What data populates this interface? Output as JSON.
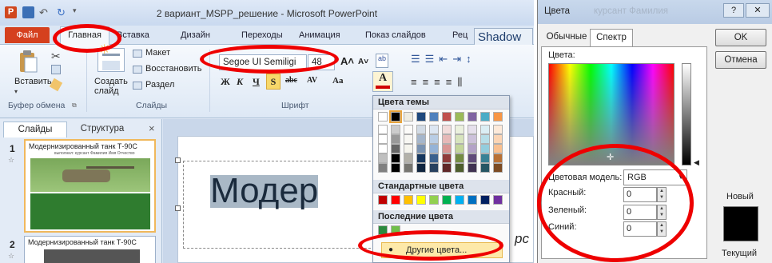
{
  "window": {
    "title": "2 вариант_MSPP_решение  -  Microsoft PowerPoint",
    "app_icon_letter": "P"
  },
  "ribbon_tabs": [
    "Файл",
    "Главная",
    "Вставка",
    "Дизайн",
    "Переходы",
    "Анимация",
    "Показ слайдов",
    "Рец"
  ],
  "ribbon": {
    "paste_label": "Вставить",
    "create_slide_label": "Создать\nслайд",
    "layout_label": "Макет",
    "reset_label": "Восстановить",
    "section_label": "Раздел",
    "font_name": "Segoe UI Semiligi",
    "font_size": "48",
    "format_buttons": [
      "Ж",
      "К",
      "Ч",
      "S",
      "abc",
      "AV",
      "Aa",
      "A"
    ],
    "groups": [
      "Буфер обмена",
      "Слайды",
      "Шрифт"
    ],
    "shadow_tooltip": "Shadow"
  },
  "slide_panel": {
    "tabs": [
      "Слайды",
      "Структура"
    ],
    "close": "×",
    "slides": [
      {
        "number": "1",
        "title": "Модернизированный танк Т-90С",
        "subtitle": "выполнил: курсант Фамилия Имя Отчество"
      },
      {
        "number": "2",
        "title": "Модернизированный танк Т-90С"
      }
    ]
  },
  "slide": {
    "title_text": "Модер",
    "right_fragment": "рс"
  },
  "palette": {
    "theme_header": "Цвета темы",
    "standard_header": "Стандартные цвета",
    "recent_header": "Последние цвета",
    "more_colors": "Другие цвета...",
    "theme_colors": [
      "#ffffff",
      "#000000",
      "#eeece1",
      "#1f497d",
      "#4f81bd",
      "#c0504d",
      "#9bbb59",
      "#8064a2",
      "#4bacc6",
      "#f79646"
    ],
    "standard_colors": [
      "#c00000",
      "#ff0000",
      "#ffc000",
      "#ffff00",
      "#92d050",
      "#00b050",
      "#00b0f0",
      "#0070c0",
      "#002060",
      "#7030a0"
    ],
    "recent_colors": [
      "#2b8a3e",
      "#6fbf4a"
    ]
  },
  "dialog": {
    "title": "Цвета",
    "title_ghost": "курсант Фамилия",
    "help": "?",
    "close": "✕",
    "tabs": [
      "Обычные",
      "Спектр"
    ],
    "ok": "OK",
    "cancel": "Отмена",
    "colors_label": "Цвета:",
    "model_label": "Цветовая модель:",
    "model_value": "RGB",
    "red_label": "Красный:",
    "green_label": "Зеленый:",
    "blue_label": "Синий:",
    "red_value": "0",
    "green_value": "0",
    "blue_value": "0",
    "new_label": "Новый",
    "current_label": "Текущий",
    "new_color": "#000000",
    "current_color": "#000000"
  },
  "colors": {
    "file_tab": "#d5401e",
    "annotation": "#e00000",
    "highlight": "#fde9a9"
  }
}
